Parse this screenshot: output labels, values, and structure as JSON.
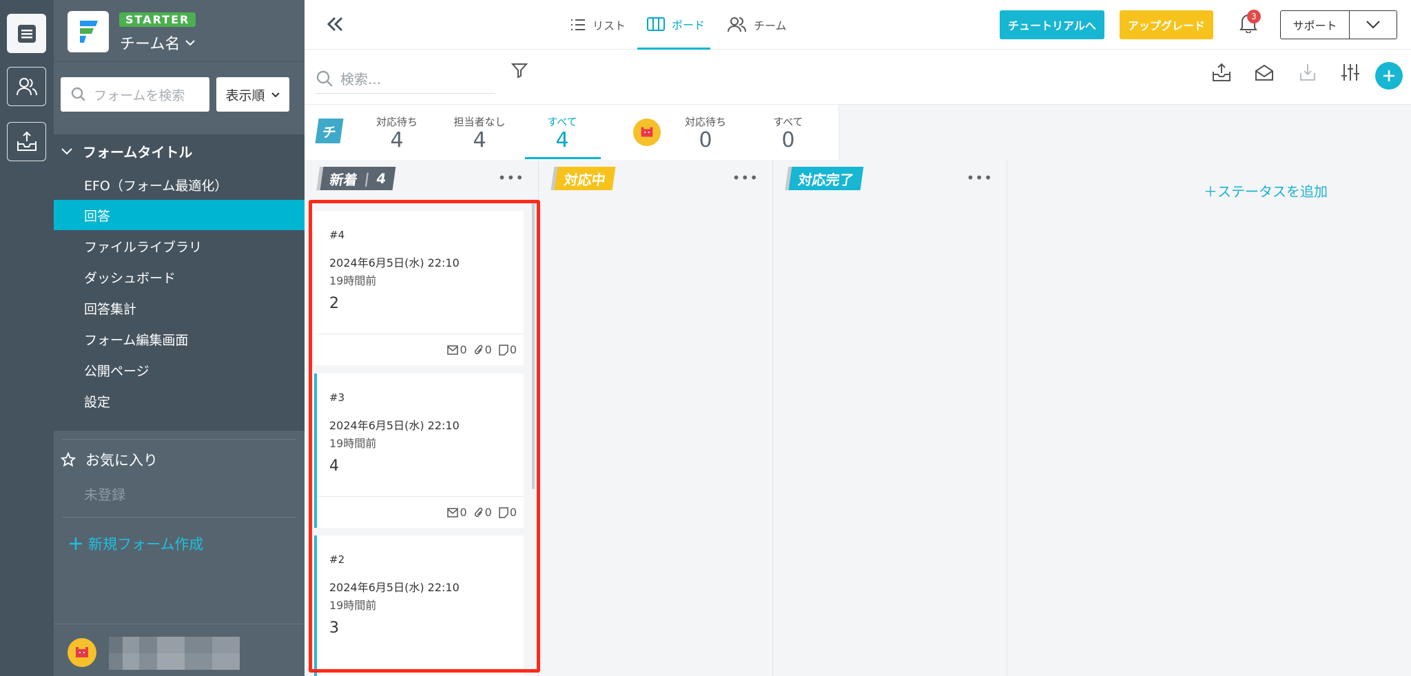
{
  "rail": {
    "items": [
      "forms-icon",
      "team-icon",
      "inbox-icon"
    ]
  },
  "sidebar": {
    "plan": "STARTER",
    "team_name": "チーム名",
    "search_placeholder": "フォームを検索",
    "sort_label": "表示順",
    "form_title": "フォームタイトル",
    "items": [
      {
        "label": "EFO（フォーム最適化）"
      },
      {
        "label": "回答",
        "active": true
      },
      {
        "label": "ファイルライブラリ"
      },
      {
        "label": "ダッシュボード"
      },
      {
        "label": "回答集計"
      },
      {
        "label": "フォーム編集画面"
      },
      {
        "label": "公開ページ"
      },
      {
        "label": "設定"
      }
    ],
    "favorites_label": "お気に入り",
    "favorites_empty": "未登録",
    "new_form_label": "新規フォーム作成"
  },
  "topbar": {
    "tabs": [
      {
        "label": "リスト"
      },
      {
        "label": "ボード",
        "active": true
      },
      {
        "label": "チーム"
      }
    ],
    "tutorial_label": "チュートリアルへ",
    "upgrade_label": "アップグレード",
    "notification_count": "3",
    "support_label": "サポート"
  },
  "toolbar": {
    "search_placeholder": "検索..."
  },
  "counts": {
    "team_tag": "チ",
    "team": [
      {
        "label": "対応待ち",
        "value": "4"
      },
      {
        "label": "担当者なし",
        "value": "4"
      },
      {
        "label": "すべて",
        "value": "4",
        "active": true
      }
    ],
    "mine": [
      {
        "label": "対応待ち",
        "value": "0"
      },
      {
        "label": "すべて",
        "value": "0"
      }
    ]
  },
  "board": {
    "columns": [
      {
        "name": "新着",
        "count": "4",
        "color": "#5b6670"
      },
      {
        "name": "対応中",
        "color": "#f7c21b"
      },
      {
        "name": "対応完了",
        "color": "#17b6d3"
      }
    ],
    "add_status_label": "＋ステータスを追加",
    "cards": [
      {
        "id": "#4",
        "date": "2024年6月5日(水) 22:10",
        "ago": "19時間前",
        "value": "2",
        "mail": "0",
        "attach": "0",
        "note": "0"
      },
      {
        "id": "#3",
        "date": "2024年6月5日(水) 22:10",
        "ago": "19時間前",
        "value": "4",
        "mail": "0",
        "attach": "0",
        "note": "0"
      },
      {
        "id": "#2",
        "date": "2024年6月5日(水) 22:10",
        "ago": "19時間前",
        "value": "3"
      }
    ]
  },
  "colors": {
    "accent": "#17b6d3",
    "sidebar": "#55646f",
    "rail": "#45535e",
    "highlight": "#ff2a1a"
  }
}
